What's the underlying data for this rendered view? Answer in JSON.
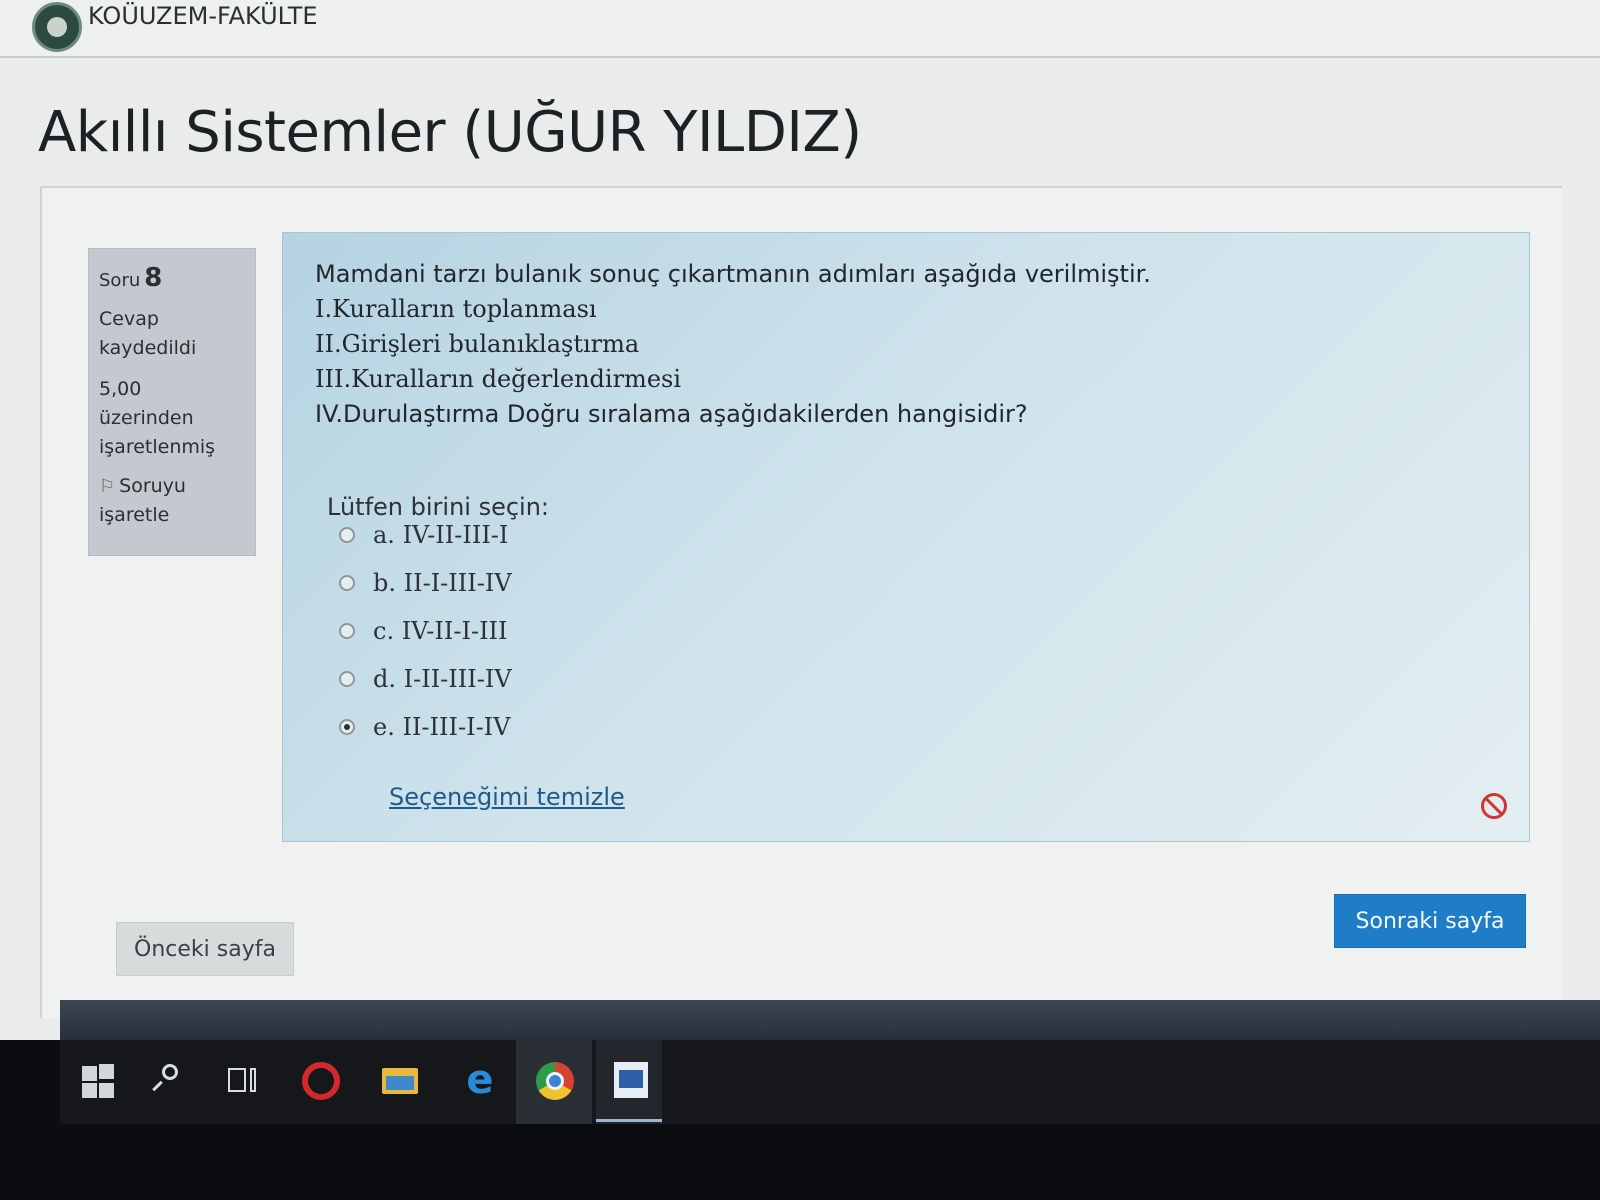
{
  "header": {
    "site_name": "KOÜUZEM-FAKÜLTE",
    "course_title": "Akıllı Sistemler (UĞUR YILDIZ)"
  },
  "question_info": {
    "label": "Soru",
    "number": "8",
    "state_line1": "Cevap",
    "state_line2": "kaydedildi",
    "mark_line1": "5,00",
    "mark_line2": "üzerinden",
    "mark_line3": "işaretlenmiş",
    "flag_line1": "Soruyu",
    "flag_line2": "işaretle"
  },
  "question": {
    "intro": "Mamdani tarzı bulanık sonuç çıkartmanın adımları aşağıda verilmiştir.",
    "step1": "I.Kuralların toplanması",
    "step2": "II.Girişleri bulanıklaştırma",
    "step3": "III.Kuralların değerlendirmesi",
    "step4": "IV.Durulaştırma Doğru sıralama aşağıdakilerden hangisidir?",
    "prompt": "Lütfen birini seçin:",
    "options": [
      {
        "label": "a. IV-II-III-I",
        "selected": false
      },
      {
        "label": "b. II-I-III-IV",
        "selected": false
      },
      {
        "label": "c. IV-II-I-III",
        "selected": false
      },
      {
        "label": "d. I-II-III-IV",
        "selected": false
      },
      {
        "label": "e. II-III-I-IV",
        "selected": true
      }
    ],
    "clear_label": "Seçeneğimi temizle"
  },
  "navigation": {
    "prev_label": "Önceki sayfa",
    "next_label": "Sonraki sayfa",
    "next_color": "#1f7cc7"
  },
  "taskbar": {
    "icons": [
      "windows-start-icon",
      "search-icon",
      "task-view-icon",
      "opera-icon",
      "file-explorer-icon",
      "edge-icon",
      "chrome-icon",
      "word-icon"
    ]
  }
}
